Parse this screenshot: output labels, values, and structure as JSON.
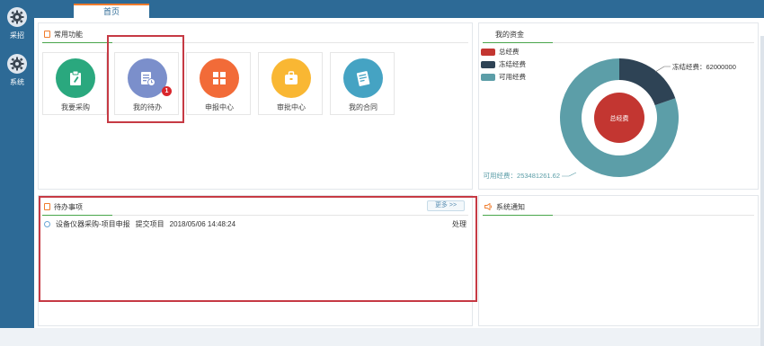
{
  "sidebar": {
    "items": [
      {
        "label": "采招",
        "icon": "gear-icon"
      },
      {
        "label": "系统",
        "icon": "gear-icon"
      }
    ]
  },
  "topbar": {
    "home_tab": "首页"
  },
  "common": {
    "title": "常用功能",
    "items": [
      {
        "label": "我要采购",
        "icon": "clipboard-pen-icon",
        "color": "#2aa87e"
      },
      {
        "label": "我的待办",
        "icon": "document-clock-icon",
        "color": "#7b8fcb",
        "badge": "1"
      },
      {
        "label": "申报中心",
        "icon": "grid-icon",
        "color": "#f26b38"
      },
      {
        "label": "审批中心",
        "icon": "briefcase-icon",
        "color": "#f9b733"
      },
      {
        "label": "我的合同",
        "icon": "contract-icon",
        "color": "#45a3c3"
      }
    ]
  },
  "funds": {
    "title": "我的资金",
    "legend": [
      {
        "label": "总经费",
        "color": "#c33631"
      },
      {
        "label": "冻结经费",
        "color": "#2e4355"
      },
      {
        "label": "可用经费",
        "color": "#5c9ea8"
      }
    ],
    "frozen_label": "冻结经费：62000000",
    "available_label": "可用经费：253481261.62",
    "center_label": "总经费"
  },
  "chart_data": {
    "type": "pie",
    "title": "",
    "series": [
      {
        "name": "冻结经费",
        "values": [
          62000000
        ]
      },
      {
        "name": "可用经费",
        "values": [
          253481261.62
        ]
      }
    ],
    "inner_series": {
      "name": "总经费"
    },
    "legend_position": "top-left"
  },
  "todo": {
    "title": "待办事项",
    "more": "更多 >>",
    "rows": [
      {
        "text": "设备仪器采购-项目申报",
        "action_type": "提交项目",
        "time": "2018/05/06 14:48:24",
        "op": "处理"
      }
    ]
  },
  "notice": {
    "title": "系统通知"
  }
}
